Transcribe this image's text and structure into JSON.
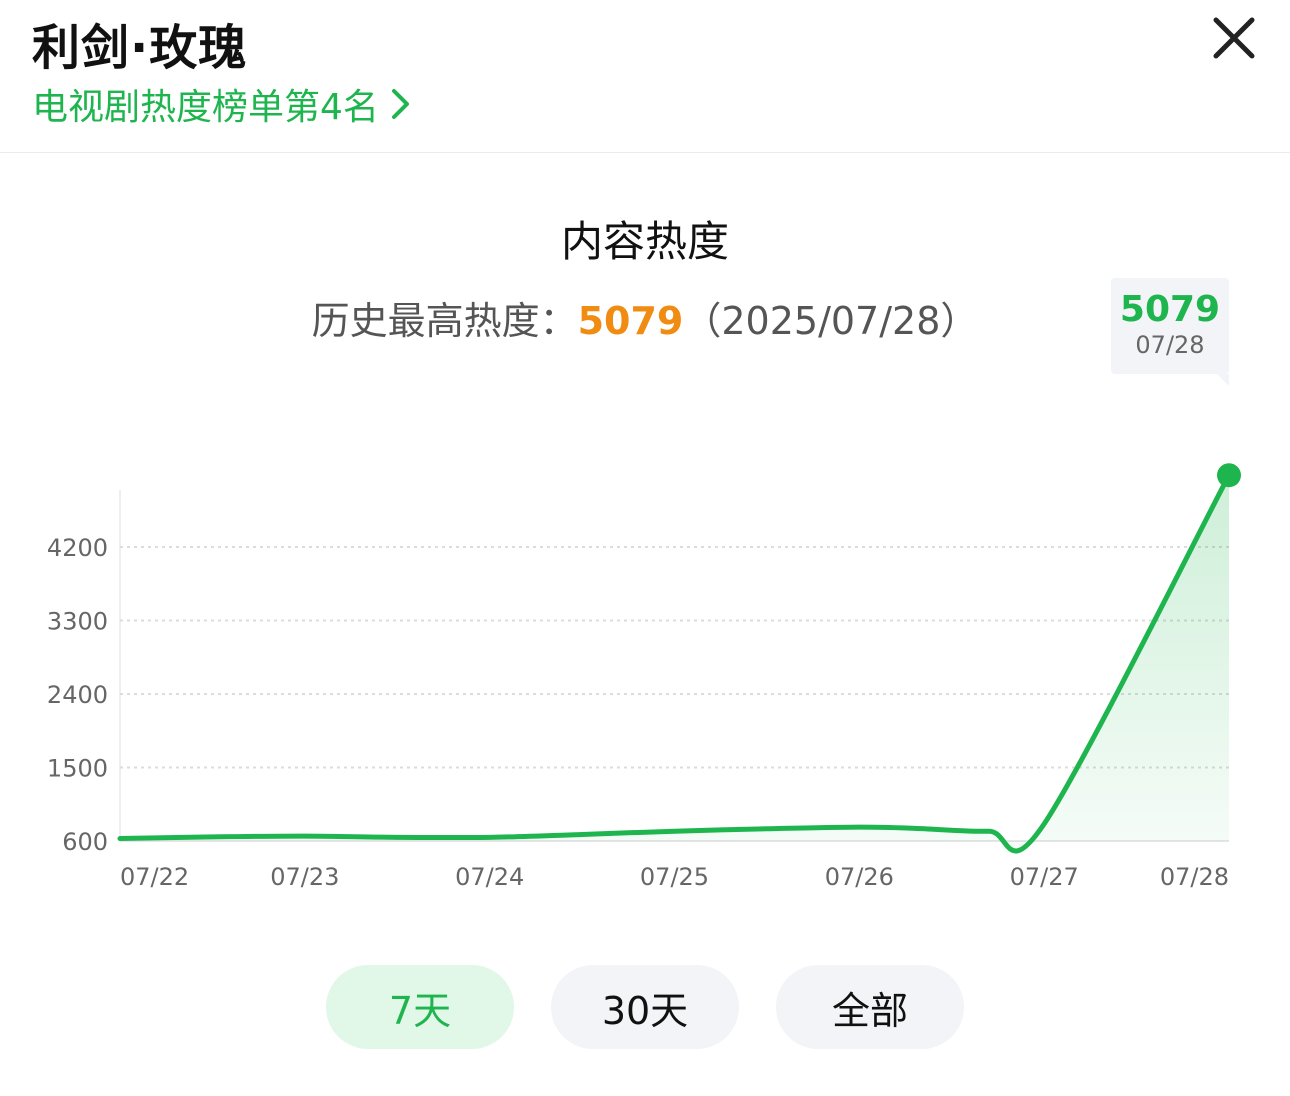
{
  "header": {
    "title": "利剑·玫瑰",
    "rank_link": "电视剧热度榜单第4名"
  },
  "section": {
    "title": "内容热度",
    "record_label": "历史最高热度：",
    "record_value": "5079",
    "record_date": "（2025/07/28）"
  },
  "tooltip": {
    "value": "5079",
    "date": "07/28"
  },
  "ranges": [
    {
      "label": "7天",
      "selected": true
    },
    {
      "label": "30天",
      "selected": false
    },
    {
      "label": "全部",
      "selected": false
    }
  ],
  "colors": {
    "accent": "#1fb54e",
    "highlight": "#f08c12",
    "fill": "#e1f7e8",
    "chip": "#f2f4f7"
  },
  "icons": {
    "close": "close-icon",
    "chevron": "chevron-right-icon"
  },
  "chart_data": {
    "type": "area",
    "x": [
      "07/22",
      "07/22.5",
      "07/23",
      "07/23.5",
      "07/24",
      "07/24.5",
      "07/25",
      "07/25.5",
      "07/26",
      "07/26.3",
      "07/26.7",
      "07/27",
      "07/28"
    ],
    "values": [
      630,
      650,
      660,
      645,
      645,
      680,
      720,
      750,
      770,
      755,
      720,
      810,
      5079
    ],
    "categories": [
      "07/22",
      "07/23",
      "07/24",
      "07/25",
      "07/26",
      "07/27",
      "07/28"
    ],
    "y_ticks": [
      600,
      1500,
      2400,
      3300,
      4200
    ],
    "ylim": [
      600,
      5079
    ],
    "grid": true,
    "marker": "last-point"
  }
}
